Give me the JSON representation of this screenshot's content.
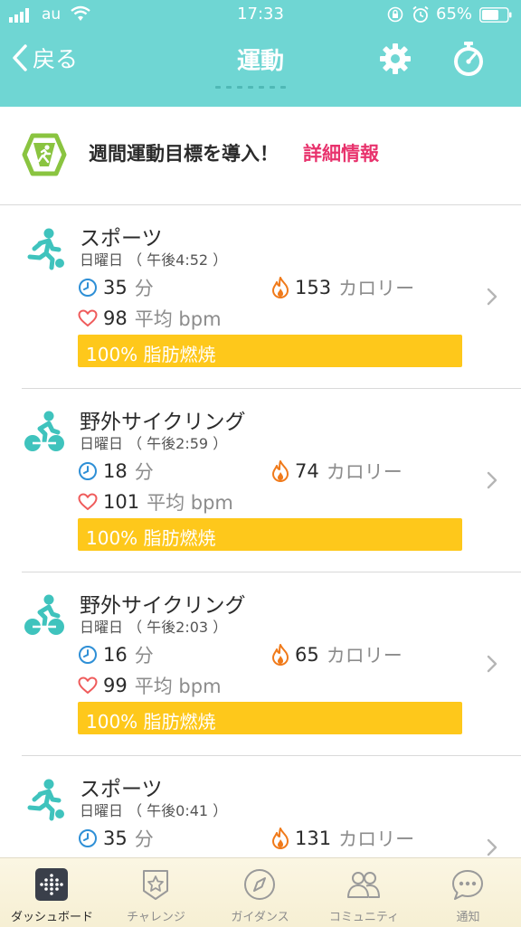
{
  "status_bar": {
    "carrier": "au",
    "time": "17:33",
    "battery": "65%"
  },
  "nav": {
    "back_label": "戻る",
    "title": "運動"
  },
  "goal": {
    "text": "週間運動目標を導入！",
    "link": "詳細情報"
  },
  "colors": {
    "header": "#6fd6d3",
    "teal_icon": "#3fc3bd",
    "burn_bar": "#fec81b",
    "link": "#e8336d"
  },
  "exercises": [
    {
      "icon": "running-person-icon",
      "name": "スポーツ",
      "time": "日曜日 （ 午後4:52 ）",
      "duration": "35",
      "duration_unit": "分",
      "calories": "153",
      "calories_unit": "カロリー",
      "heart_rate": "98",
      "heart_rate_unit": "平均 bpm",
      "fat_burn": "100% 脂肪燃焼"
    },
    {
      "icon": "cycling-person-icon",
      "name": "野外サイクリング",
      "time": "日曜日 （ 午後2:59 ）",
      "duration": "18",
      "duration_unit": "分",
      "calories": "74",
      "calories_unit": "カロリー",
      "heart_rate": "101",
      "heart_rate_unit": "平均 bpm",
      "fat_burn": "100% 脂肪燃焼"
    },
    {
      "icon": "cycling-person-icon",
      "name": "野外サイクリング",
      "time": "日曜日 （ 午後2:03 ）",
      "duration": "16",
      "duration_unit": "分",
      "calories": "65",
      "calories_unit": "カロリー",
      "heart_rate": "99",
      "heart_rate_unit": "平均 bpm",
      "fat_burn": "100% 脂肪燃焼"
    },
    {
      "icon": "running-person-icon",
      "name": "スポーツ",
      "time": "日曜日 （ 午後0:41 ）",
      "duration": "35",
      "duration_unit": "分",
      "calories": "131",
      "calories_unit": "カロリー",
      "heart_rate": "",
      "heart_rate_unit": "",
      "fat_burn": ""
    }
  ],
  "tabs": [
    {
      "label": "ダッシュボード",
      "icon": "dashboard-icon",
      "active": true
    },
    {
      "label": "チャレンジ",
      "icon": "challenge-star-icon",
      "active": false
    },
    {
      "label": "ガイダンス",
      "icon": "compass-icon",
      "active": false
    },
    {
      "label": "コミュニティ",
      "icon": "community-people-icon",
      "active": false
    },
    {
      "label": "通知",
      "icon": "notification-bubble-icon",
      "active": false
    }
  ]
}
